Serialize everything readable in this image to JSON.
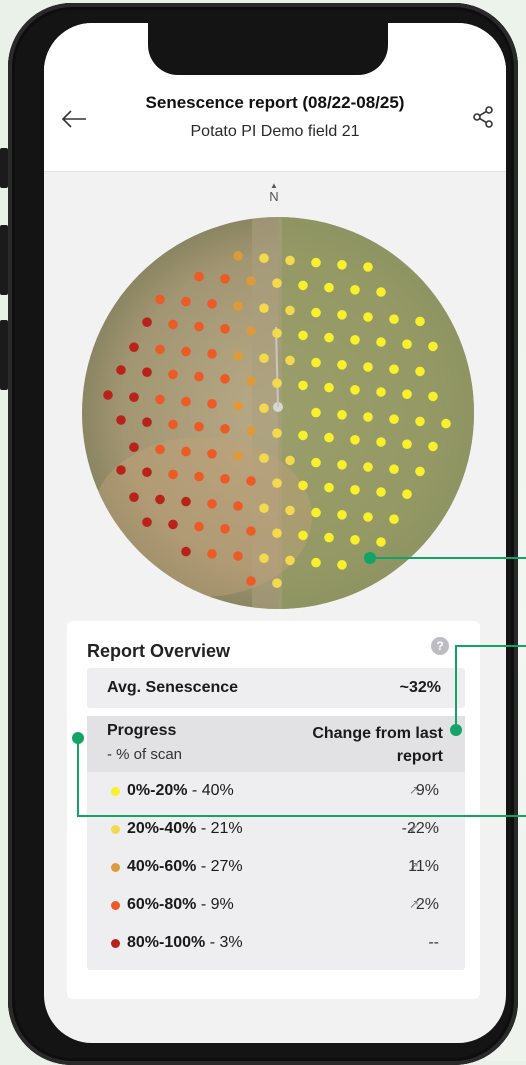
{
  "header": {
    "title": "Senescence report (08/22-08/25)",
    "subtitle": "Potato PI Demo field 21"
  },
  "map": {
    "north_label": "N"
  },
  "overview": {
    "title": "Report Overview",
    "help_label": "?",
    "avg_label": "Avg. Senescence",
    "avg_value": "~32%",
    "col_progress": "Progress",
    "col_progress_sub": "- % of scan",
    "col_change_line1": "Change from last",
    "col_change_line2": "report",
    "rows": [
      {
        "range": "0%-20%",
        "pct": " - 40%",
        "arrow": "↗",
        "change": "9%",
        "color": "#f7f02a"
      },
      {
        "range": "20%-40%",
        "pct": " - 21%",
        "arrow": "↙",
        "change": "-22%",
        "color": "#f2d94e"
      },
      {
        "range": "40%-60%",
        "pct": " - 27%",
        "arrow": "↗",
        "change": "11%",
        "color": "#dd9a3c"
      },
      {
        "range": "60%-80%",
        "pct": " - 9%",
        "arrow": "↗",
        "change": "2%",
        "color": "#ec5a26"
      },
      {
        "range": "80%-100%",
        "pct": " - 3%",
        "arrow": "",
        "change": "--",
        "color": "#b8221a"
      }
    ]
  },
  "colors": {
    "accent_green": "#14a366",
    "bin_0_20": "#f7f02a",
    "bin_20_40": "#f2d94e",
    "bin_40_60": "#dd9a3c",
    "bin_60_80": "#ec5a26",
    "bin_80_100": "#b8221a"
  },
  "icons": {
    "back": "arrow-left-icon",
    "share": "share-icon",
    "help": "question-icon",
    "north": "north-arrow-icon"
  }
}
